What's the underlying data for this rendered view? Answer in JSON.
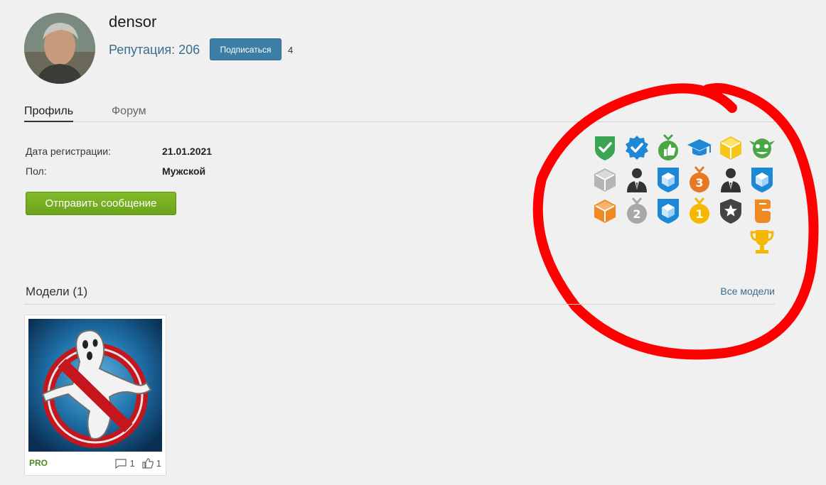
{
  "profile": {
    "username": "densor",
    "reputation_label": "Репутация: 206",
    "subscribe_label": "Подписаться",
    "subscribers_count": "4"
  },
  "tabs": [
    {
      "label": "Профиль",
      "active": true
    },
    {
      "label": "Форум",
      "active": false
    }
  ],
  "info": {
    "registration_label": "Дата регистрации:",
    "registration_value": "21.01.2021",
    "gender_label": "Пол:",
    "gender_value": "Мужской"
  },
  "send_message_label": "Отправить сообщение",
  "badges": [
    {
      "icon": "green-shield-check-icon",
      "color": "#3aa655"
    },
    {
      "icon": "blue-verified-check-icon",
      "color": "#1e88d6"
    },
    {
      "icon": "green-thumbs-up-medal-icon",
      "color": "#4aa843"
    },
    {
      "icon": "graduation-cap-icon",
      "color": "#1e88d6"
    },
    {
      "icon": "yellow-cube-icon",
      "color": "#f5c518"
    },
    {
      "icon": "green-goblin-icon",
      "color": "#4aa843"
    },
    {
      "icon": "gray-cube-icon",
      "color": "#b5b5b5"
    },
    {
      "icon": "businessman-icon",
      "color": "#333333"
    },
    {
      "icon": "blue-cube-shield-icon",
      "color": "#1e88d6"
    },
    {
      "icon": "bronze-medal-3-icon",
      "color": "#e87722"
    },
    {
      "icon": "businessman-icon",
      "color": "#333333"
    },
    {
      "icon": "blue-cube-shield-icon",
      "color": "#1e88d6"
    },
    {
      "icon": "orange-cube-icon",
      "color": "#ef8a22"
    },
    {
      "icon": "silver-medal-2-icon",
      "color": "#a8a8a8"
    },
    {
      "icon": "blue-cube-shield-icon",
      "color": "#1e88d6"
    },
    {
      "icon": "gold-medal-1-icon",
      "color": "#f5b800"
    },
    {
      "icon": "star-shield-icon",
      "color": "#444444"
    },
    {
      "icon": "orange-fist-icon",
      "color": "#ef8a22"
    },
    {
      "icon": "gold-trophy-icon",
      "color": "#f5b800"
    }
  ],
  "models": {
    "title": "Модели (1)",
    "all_link": "Все модели",
    "items": [
      {
        "badge": "PRO",
        "comments": "1",
        "likes": "1",
        "thumb_icon": "ghostbusters-logo-icon"
      }
    ]
  },
  "colors": {
    "background": "#f0f0f0",
    "link": "#3a6e8f",
    "subscribe": "#3d7ea6",
    "send_button": "#6ba21a",
    "annotation": "#ff0000"
  }
}
